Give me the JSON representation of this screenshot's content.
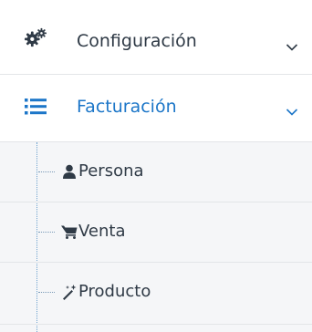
{
  "menu": {
    "configuracion": {
      "label": "Configuración",
      "icon": "cogs-icon",
      "chevron": "chevron-down-icon"
    },
    "facturacion": {
      "label": "Facturación",
      "icon": "list-icon",
      "chevron": "chevron-down-icon",
      "expanded": true,
      "submenu": [
        {
          "label": "Persona",
          "icon": "user-icon"
        },
        {
          "label": "Venta",
          "icon": "cart-icon"
        },
        {
          "label": "Producto",
          "icon": "magic-wand-icon"
        }
      ]
    }
  },
  "colors": {
    "active_text": "#1c76c8",
    "text": "#2f3a46",
    "submenu_bg": "#f5f6f8",
    "divider": "#e3e5e8"
  }
}
